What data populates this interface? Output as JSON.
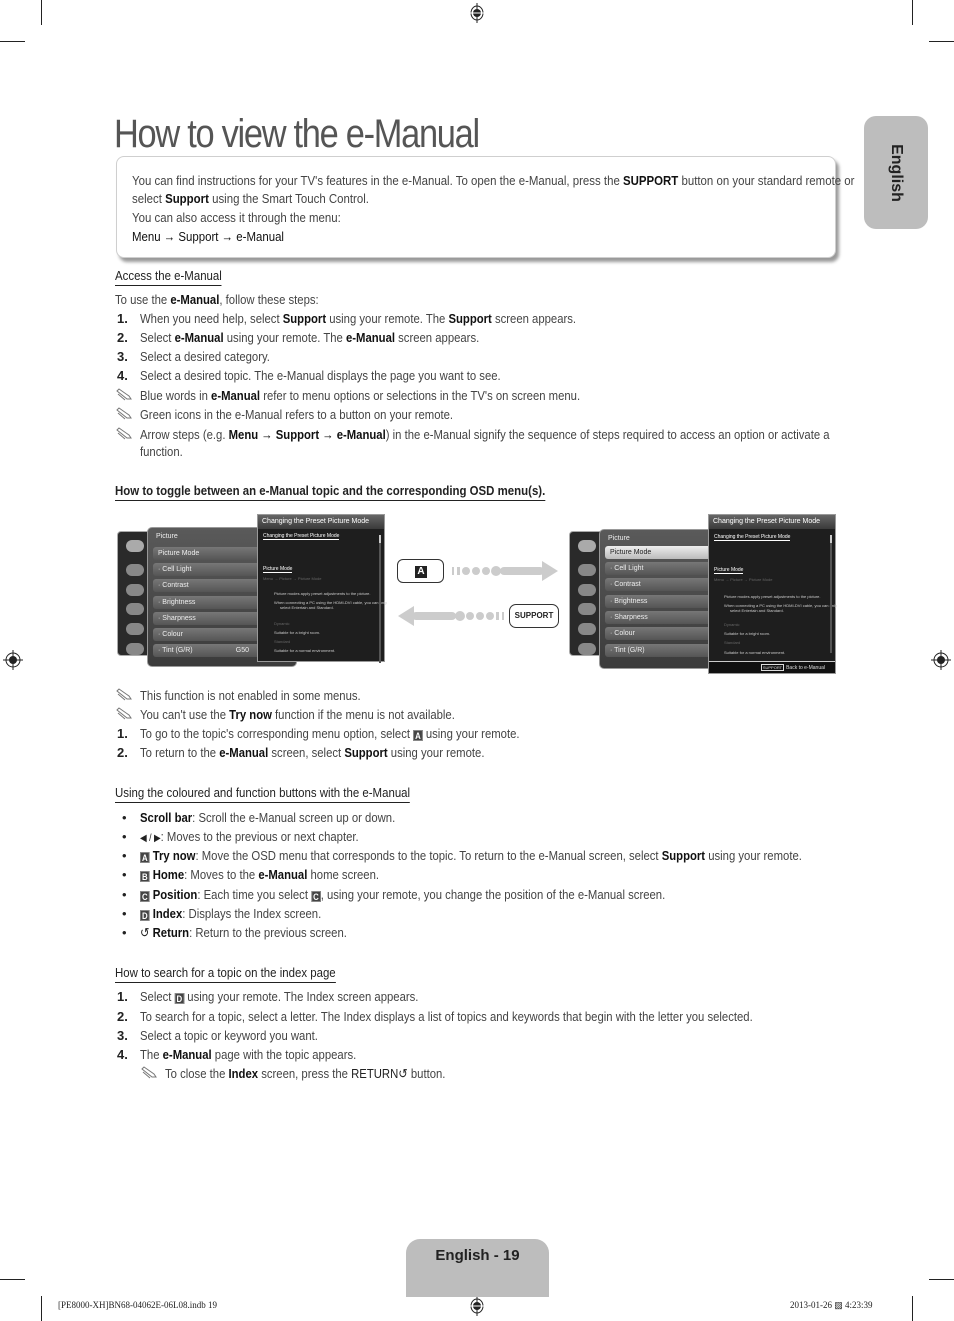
{
  "page": {
    "title": "How to view the e-Manual",
    "language_tab": "English",
    "page_number_label": "English - 19"
  },
  "intro": {
    "line1_a": "You can find instructions for your TV's features in the e-Manual. To open the e-Manual, press the ",
    "line1_b": "SUPPORT",
    "line1_c": " button on your standard remote or",
    "line2_a": "select ",
    "line2_b": "Support",
    "line2_c": " using the Smart Touch Control.",
    "line3": "You can also access it through the menu:",
    "menu_path": "Menu → Support → e-Manual"
  },
  "access": {
    "heading": "Access the e-Manual",
    "lead_a": "To use the ",
    "lead_b": "e-Manual",
    "lead_c": ", follow these steps:",
    "steps": [
      {
        "n": "1.",
        "a": "When you need help, select ",
        "b": "Support",
        "c": " using your remote. The ",
        "d": "Support",
        "e": " screen appears."
      },
      {
        "n": "2.",
        "a": "Select ",
        "b": "e-Manual",
        "c": " using your remote. The ",
        "d": "e-Manual",
        "e": " screen appears."
      },
      {
        "n": "3.",
        "a": "Select a desired category."
      },
      {
        "n": "4.",
        "a": "Select a desired topic. The e-Manual displays the page you want to see."
      }
    ],
    "notes": [
      {
        "a": "Blue words in ",
        "b": "e-Manual",
        "c": " refer to menu options or selections in the TV's on screen menu."
      },
      {
        "a": "Green icons in the e-Manual refers to a button on your remote."
      },
      {
        "a": "Arrow steps (e.g. ",
        "b": "Menu → Support → e-Manual",
        "c": ") in the e-Manual signify the sequence of steps required to access an option or activate a",
        "d": "function."
      }
    ]
  },
  "toggle": {
    "heading": "How to toggle between an e-Manual topic and the corresponding OSD menu(s).",
    "key_a": "A",
    "key_support": "SUPPORT",
    "tv_menu": {
      "title": "Picture",
      "items": [
        "Picture Mode",
        "Cell Light",
        "Contrast",
        "Brightness",
        "Sharpness",
        "Colour",
        "Tint (G/R)"
      ],
      "tint_value": "G50"
    },
    "tv_panel": {
      "header": "Changing the Preset Picture Mode",
      "subtitle": "Changing the Preset Picture Mode",
      "section": "Picture Mode",
      "path": "Menu → Picture → Picture Mode",
      "desc": "Picture modes apply preset adjustments to the picture.",
      "note1": "When connecting a PC using the HDMI-DVI cable, you can only",
      "note2": "select Entertain and Standard.",
      "opt1": "Dynamic",
      "opt1_desc": "Suitable for a bright room.",
      "opt2": "Standard",
      "opt2_desc": "Suitable for a normal environment.",
      "footer_key": "SUPPORT",
      "footer_label": "Back to e-Manual"
    },
    "notes": [
      {
        "a": "This function is not enabled in some menus."
      },
      {
        "a": "You can't use the ",
        "b": "Try now",
        "c": " function if the menu is not available."
      }
    ],
    "steps": [
      {
        "n": "1.",
        "a": "To go to the topic's corresponding menu option, select ",
        "key": "A",
        "c": " using your remote."
      },
      {
        "n": "2.",
        "a": "To return to the ",
        "b": "e-Manual",
        "c": " screen, select ",
        "d": "Support",
        "e": " using your remote."
      }
    ]
  },
  "buttons": {
    "heading": "Using the coloured and function buttons with the e-Manual",
    "items": [
      {
        "b": "Scroll bar",
        "c": ": Scroll the e-Manual screen up or down."
      },
      {
        "glyph": "◀ / ▶",
        "c": ": Moves to the previous or next chapter."
      },
      {
        "key": "A",
        "b": "Try now",
        "c": ": Move the OSD menu that corresponds to the topic. To return to the e-Manual screen, select ",
        "d": "Support",
        "e": " using your remote."
      },
      {
        "key": "B",
        "b": "Home",
        "c": ": Moves to the ",
        "d": "e-Manual",
        "e": " home screen."
      },
      {
        "key": "C",
        "b": "Position",
        "c": ": Each time you select ",
        "key2": "C",
        "e": ", using your remote, you change the position of the e-Manual screen."
      },
      {
        "key": "D",
        "b": "Index",
        "c": ": Displays the Index screen."
      },
      {
        "glyph": "↺",
        "b": "Return",
        "c": ": Return to the previous screen."
      }
    ]
  },
  "search": {
    "heading": "How to search for a topic on the index page",
    "steps": [
      {
        "n": "1.",
        "a": "Select ",
        "key": "D",
        "c": " using your remote. The Index screen appears."
      },
      {
        "n": "2.",
        "a": "To search for a topic, select a letter. The Index displays a list of topics and keywords that begin with the letter you selected."
      },
      {
        "n": "3.",
        "a": "Select a topic or keyword you want."
      },
      {
        "n": "4.",
        "a": "The ",
        "b": "e-Manual",
        "c": " page with the topic appears."
      }
    ],
    "note": {
      "a": "To close the ",
      "b": "Index",
      "c": " screen, press the ",
      "d": "RETURN↺",
      "e": " button."
    }
  },
  "footer": {
    "file": "[PE8000-XH]BN68-04062E-06L08.indb   19",
    "timestamp": "2013-01-26   ▨ 4:23:39"
  }
}
